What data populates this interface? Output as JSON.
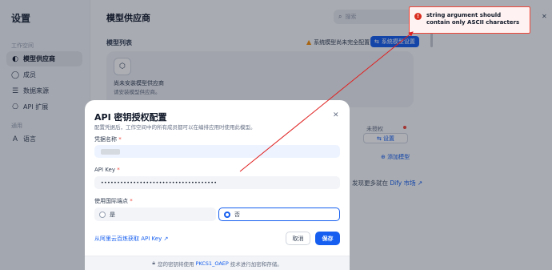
{
  "sidebar": {
    "title": "设置",
    "section_workspace": "工作空间",
    "items": [
      {
        "label": "模型供应商",
        "icon": "cube-icon"
      },
      {
        "label": "成员",
        "icon": "user-icon"
      },
      {
        "label": "数据来源",
        "icon": "database-icon"
      },
      {
        "label": "API 扩展",
        "icon": "api-icon"
      }
    ],
    "section_general": "通用",
    "general_items": [
      {
        "label": "语言",
        "icon": "translate-icon"
      }
    ]
  },
  "main": {
    "title": "模型供应商",
    "search_placeholder": "搜索",
    "section_label": "模型列表",
    "warning": "系统模型尚未完全配置",
    "config_button": "系统模型设置",
    "empty_title": "尚未安装模型供应商",
    "empty_sub": "请安装模型供应商。",
    "unauth": "未授权",
    "setting": "设置",
    "add_model": "添加模型",
    "more_text": "发现更多就在",
    "more_link": "Dify 市场"
  },
  "modal": {
    "title": "API 密钥授权配置",
    "subtitle": "配置凭据后，工作空间中的所有成员都可以在编排应用时使用此模型。",
    "name_label": "凭据名称",
    "api_key_label": "API Key",
    "api_key_value": "••••••••••••••••••••••••••••••••••••",
    "endpoint_label": "使用国际端点",
    "option_yes": "是",
    "option_no": "否",
    "get_key_link": "从阿里云百炼获取 API Key",
    "cancel": "取消",
    "save": "保存",
    "footer_pre": "您的密钥将使用",
    "footer_link": "PKCS1_OAEP",
    "footer_post": "技术进行加密和存储。"
  },
  "toast": {
    "message": "string argument should contain only ASCII characters"
  },
  "colors": {
    "accent": "#155eef",
    "error": "#f04438",
    "warning": "#f79009"
  }
}
